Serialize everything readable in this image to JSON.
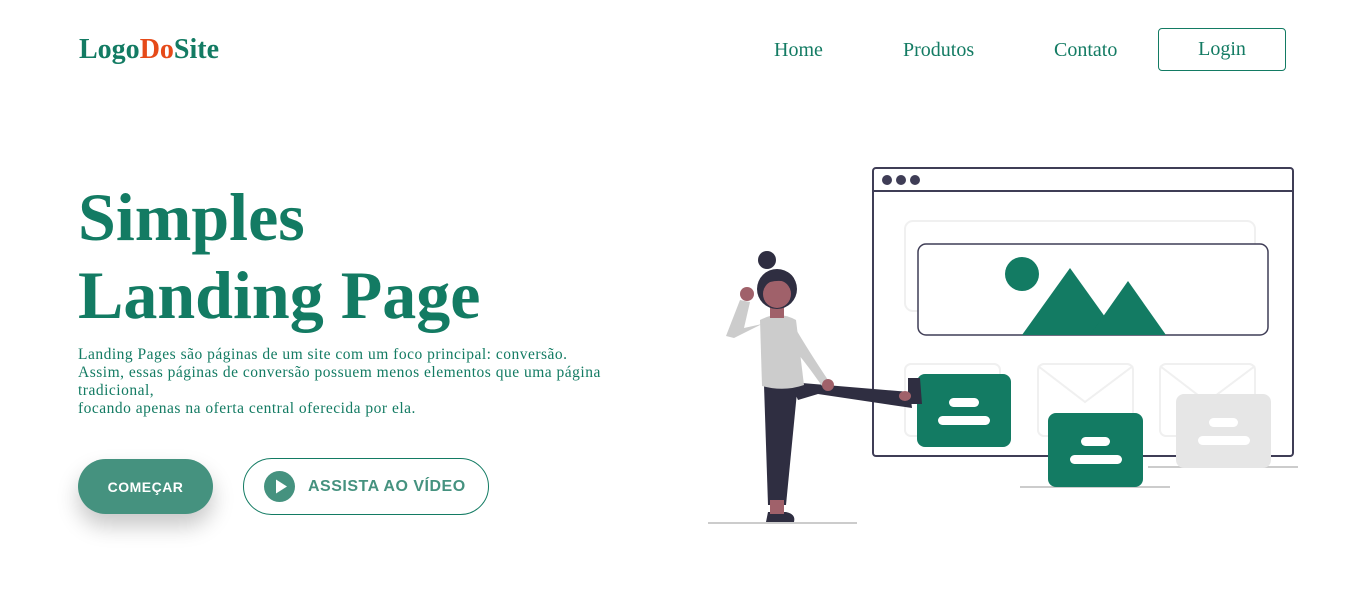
{
  "header": {
    "logo_part1": "Logo",
    "logo_part2": "Do",
    "logo_part3": "Site",
    "nav": {
      "home": "Home",
      "produtos": "Produtos",
      "contato": "Contato"
    },
    "login_label": "Login"
  },
  "hero": {
    "title_line1": "Simples",
    "title_line2": "Landing Page",
    "description": {
      "line1": "Landing Pages são páginas de um site com um foco principal: conversão.",
      "line2": "Assim, essas páginas de conversão possuem menos elementos que uma página tradicional,",
      "line3": "focando apenas na oferta central oferecida por ela."
    },
    "start_button": "COMEÇAR",
    "video_button": "ASSISTA AO VÍDEO"
  },
  "colors": {
    "brand": "#137b63",
    "accent": "#e64a19",
    "button_fill": "#45927f",
    "skin": "#a0616a",
    "dark": "#2f2e41",
    "light_gray": "#e6e6e6"
  },
  "icons": {
    "play": "play-icon",
    "illustration": "landing-page-illustration"
  }
}
